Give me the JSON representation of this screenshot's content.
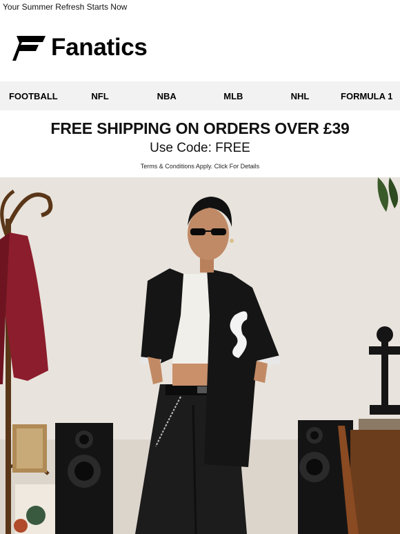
{
  "preheader": {
    "text": "Your Summer Refresh Starts Now"
  },
  "brand": {
    "name": "Fanatics",
    "logo_icon": "fanatics-flag-icon",
    "color": "#000000"
  },
  "nav": {
    "background": "#f2f2f2",
    "items": [
      {
        "label": "FOOTBALL"
      },
      {
        "label": "NFL"
      },
      {
        "label": "NBA"
      },
      {
        "label": "MLB"
      },
      {
        "label": "NHL"
      },
      {
        "label": "FORMULA 1"
      }
    ]
  },
  "promo": {
    "headline": "FREE SHIPPING ON ORDERS OVER £39",
    "code_line": "Use Code: FREE",
    "terms": "Terms & Conditions Apply. Click For Details"
  },
  "hero": {
    "subject": "model-in-black-white-sox-jersey",
    "colors": {
      "wall": "#e8e3dc",
      "jersey": "#151515",
      "accent_red": "#8c1d2c"
    }
  }
}
